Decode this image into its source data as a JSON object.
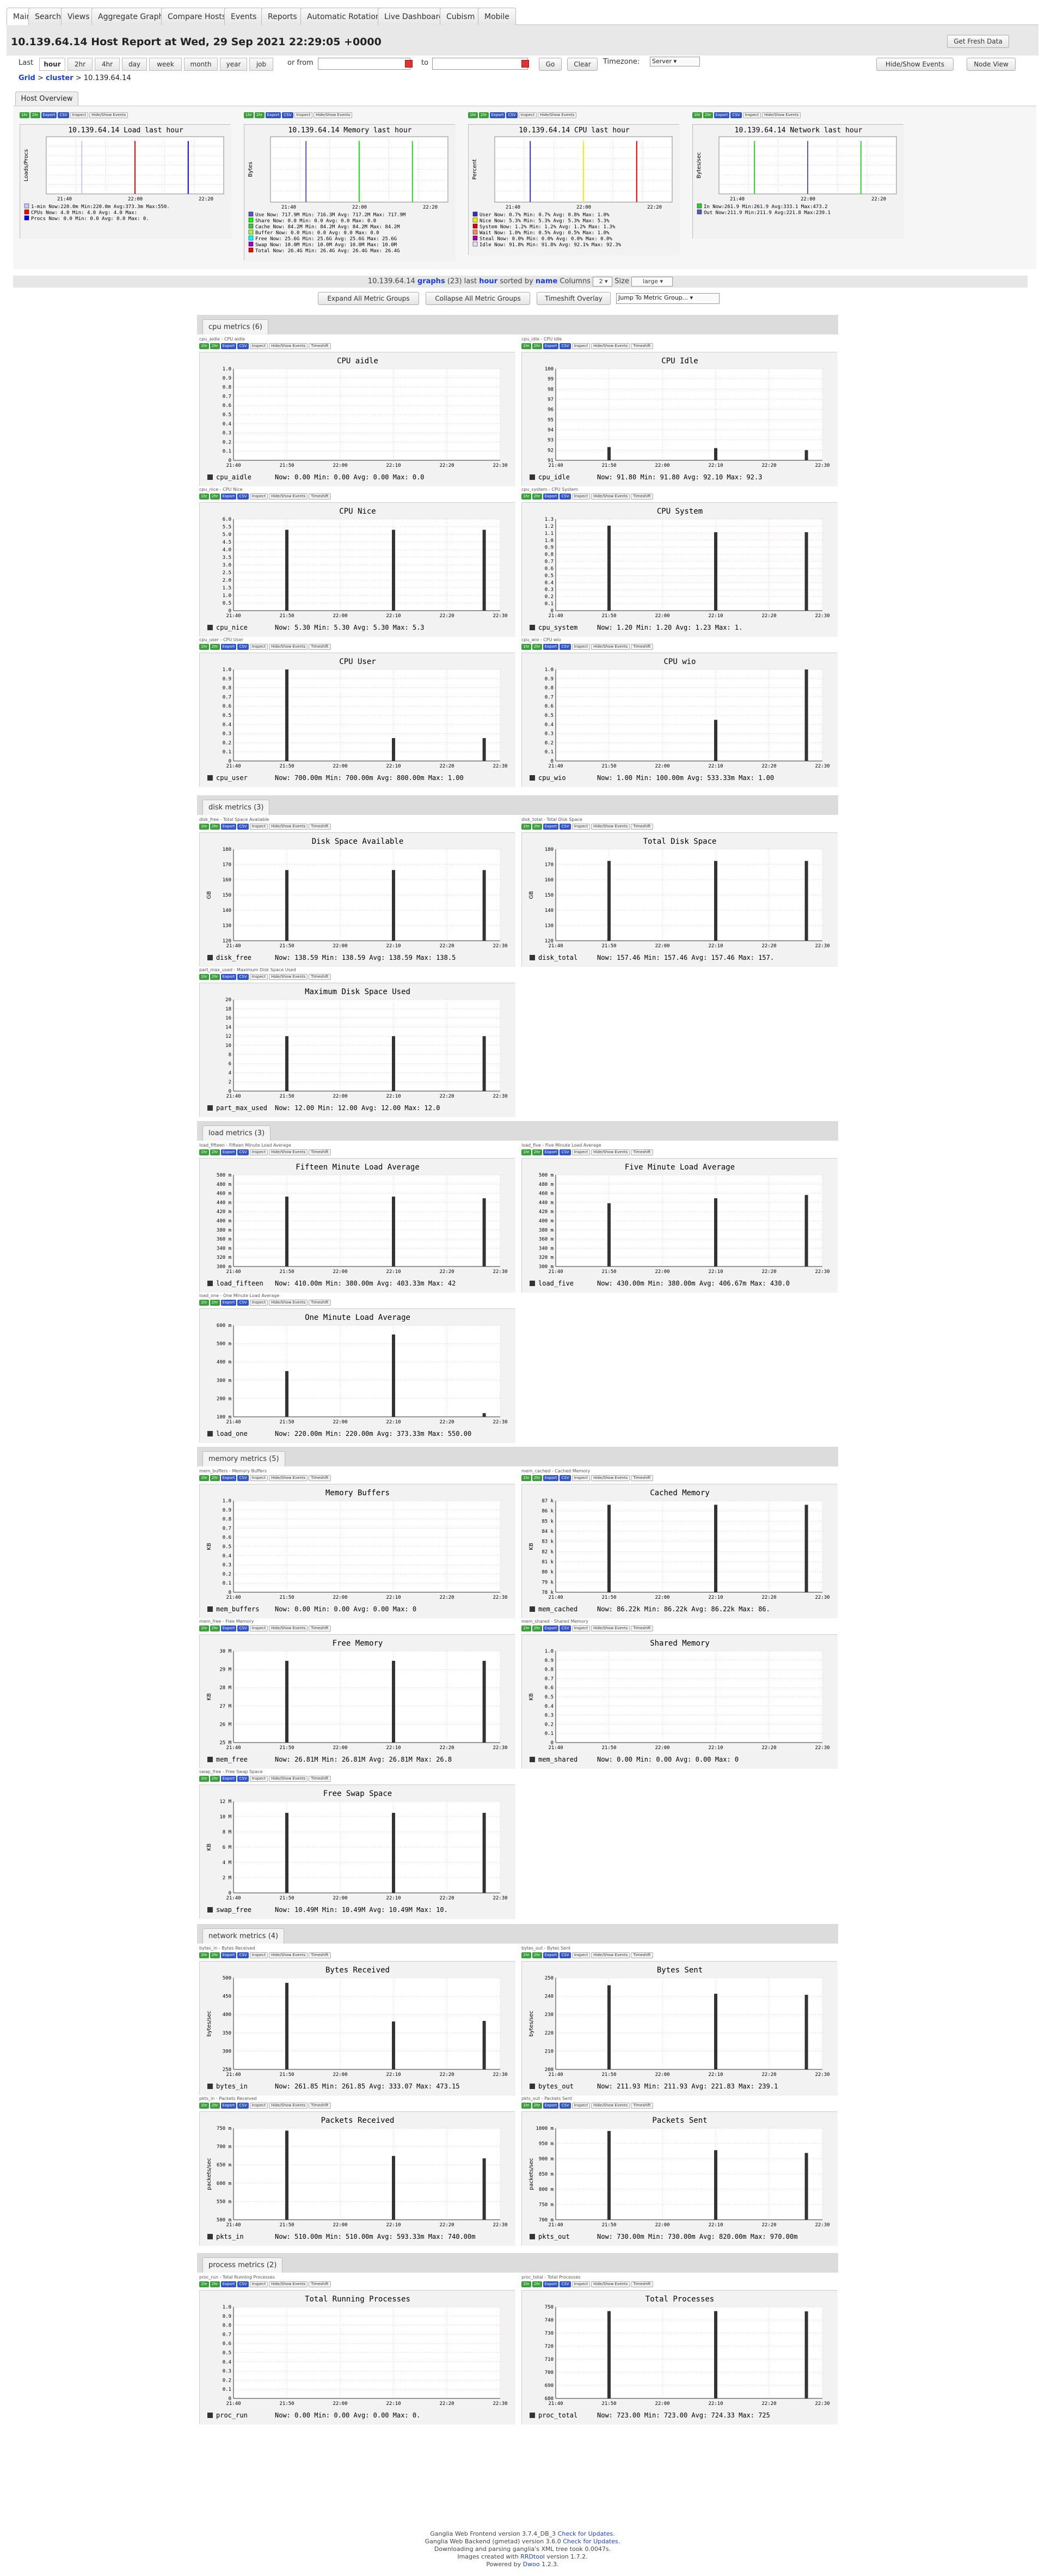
{
  "tabs": [
    "Main",
    "Search",
    "Views",
    "Aggregate Graphs",
    "Compare Hosts",
    "Events",
    "Reports",
    "Automatic Rotation",
    "Live Dashboard",
    "Cubism",
    "Mobile"
  ],
  "title": "10.139.64.14 Host Report at Wed, 29 Sep 2021 22:29:05 +0000",
  "get_fresh": "Get Fresh Data",
  "range": {
    "last_label": "Last",
    "ranges": [
      "hour",
      "2hr",
      "4hr",
      "day",
      "week",
      "month",
      "year",
      "job"
    ],
    "or_from": "or from",
    "to": "to",
    "go": "Go",
    "clear": "Clear",
    "timezone_label": "Timezone:",
    "timezone": "Server"
  },
  "hide_show_events": "Hide/Show Events",
  "node_view": "Node View",
  "breadcrumb": {
    "grid": "Grid",
    "sep1": " > ",
    "cluster": "cluster",
    "sep2": " > ",
    "host": "10.139.64.14"
  },
  "overview_tab": "Host Overview",
  "mini_labels": {
    "one": "1hr",
    "two": "2hr",
    "exp": "Export",
    "csv": "CSV",
    "json": "JSON",
    "inspect": "Inspect",
    "hse": "Hide/Show Events",
    "ts": "Timeshift"
  },
  "overview": [
    {
      "title": "10.139.64.14 Load last hour",
      "ylabel": "Loads/Procs",
      "x": [
        "21:40",
        "22:00",
        "22:20"
      ],
      "legend": [
        "1-min   Now:220.0m  Min:220.0m  Avg:373.3m  Max:550.",
        "CPUs    Now:  4.0   Min:  4.0   Avg:  4.0   Max:",
        "Procs   Now:  0.0   Min:  0.0   Avg:  0.0   Max:  0."
      ]
    },
    {
      "title": "10.139.64.14 Memory last hour",
      "ylabel": "Bytes",
      "x": [
        "21:40",
        "22:00",
        "22:20"
      ],
      "legend": [
        "Use    Now: 717.9M  Min: 716.3M  Avg: 717.2M  Max: 717.9M",
        "Share  Now:   0.0   Min:   0.0   Avg:   0.0   Max:   0.0",
        "Cache  Now:  84.2M  Min:  84.2M  Avg:  84.2M  Max:  84.2M",
        "Buffer Now:   0.0   Min:   0.0   Avg:   0.0   Max:   0.0",
        "Free   Now:  25.6G  Min:  25.6G  Avg:  25.6G  Max:  25.6G",
        "Swap   Now:  10.0M  Min:  10.0M  Avg:  10.0M  Max:  10.0M",
        "Total  Now:  26.4G  Min:  26.4G  Avg:  26.4G  Max:  26.4G"
      ]
    },
    {
      "title": "10.139.64.14 CPU last hour",
      "ylabel": "Percent",
      "x": [
        "21:40",
        "22:00",
        "22:20"
      ],
      "legend": [
        "User    Now:  0.7%  Min:  0.7%  Avg:  0.8%  Max:  1.0%",
        "Nice    Now:  5.3%  Min:  5.3%  Avg:  5.3%  Max:  5.3%",
        "System  Now:  1.2%  Min:  1.2%  Avg:  1.2%  Max:  1.3%",
        "Wait    Now:  1.0%  Min:  0.5%  Avg:  0.5%  Max:  1.0%",
        "Steal   Now:  0.0%  Min:  0.0%  Avg:  0.0%  Max:  0.0%",
        "Idle    Now: 91.8%  Min: 91.8%  Avg: 92.1%  Max: 92.3%"
      ]
    },
    {
      "title": "10.139.64.14 Network last hour",
      "ylabel": "Bytes/sec",
      "x": [
        "21:40",
        "22:00",
        "22:20"
      ],
      "legend": [
        "In    Now:261.9   Min:261.9   Avg:333.1   Max:473.2",
        "Out   Now:211.9   Min:211.9   Avg:221.8   Max:239.1"
      ]
    }
  ],
  "summary": {
    "host": "10.139.64.14",
    "graphs": "graphs",
    "count": "(23)",
    "last": "last",
    "hour": "hour",
    "sorted": "sorted by",
    "name": "name",
    "columns_label": "Columns",
    "columns": "2",
    "size_label": "Size",
    "size": "large"
  },
  "controls": [
    "Expand All Metric Groups",
    "Collapse All Metric Groups",
    "Timeshift Overlay"
  ],
  "jump": "Jump To Metric Group...",
  "groups": [
    {
      "label": "cpu metrics (6)",
      "graphs": [
        {
          "cap": "cpu_aidle - CPU aidle",
          "title": "CPU aidle",
          "metric": "cpu_aidle",
          "legend": "Now:    0.00   Min:    0.00   Avg:    0.00   Max:    0.0",
          "ymin": 0,
          "ymax": 1,
          "yticks": [
            "0",
            "0.1",
            "0.2",
            "0.3",
            "0.4",
            "0.5",
            "0.6",
            "0.7",
            "0.8",
            "0.9",
            "1.0"
          ],
          "bars": [
            0,
            0,
            0
          ]
        },
        {
          "cap": "cpu_idle - CPU Idle",
          "title": "CPU Idle",
          "metric": "cpu_idle",
          "legend": "Now:   91.80   Min:   91.80   Avg:   92.10   Max:   92.3",
          "ymin": 91,
          "ymax": 100,
          "yticks": [
            "91",
            "92",
            "93",
            "94",
            "95",
            "96",
            "97",
            "98",
            "99",
            "100"
          ],
          "bars": [
            92.3,
            92.2,
            92.0
          ]
        },
        {
          "cap": "cpu_nice - CPU Nice",
          "title": "CPU Nice",
          "metric": "cpu_nice",
          "legend": "Now:    5.30   Min:    5.30   Avg:    5.30   Max:    5.3",
          "ymin": 0,
          "ymax": 6,
          "yticks": [
            "0",
            "0.5",
            "1.0",
            "1.5",
            "2.0",
            "2.5",
            "3.0",
            "3.5",
            "4.0",
            "4.5",
            "5.0",
            "5.5",
            "6.0"
          ],
          "bars": [
            5.3,
            5.3,
            5.3
          ]
        },
        {
          "cap": "cpu_system - CPU System",
          "title": "CPU System",
          "metric": "cpu_system",
          "legend": "Now:    1.20   Min:    1.20   Avg:    1.23   Max:    1.",
          "ymin": 0,
          "ymax": 1.4,
          "yticks": [
            "0",
            "0.1",
            "0.2",
            "0.3",
            "0.4",
            "0.5",
            "0.6",
            "0.7",
            "0.8",
            "0.9",
            "1.0",
            "1.1",
            "1.2",
            "1.3"
          ],
          "bars": [
            1.3,
            1.2,
            1.2
          ]
        },
        {
          "cap": "cpu_user - CPU User",
          "title": "CPU User",
          "metric": "cpu_user",
          "legend": "Now:  700.00m  Min:  700.00m  Avg:  800.00m  Max:  1.00",
          "ymin": 0,
          "ymax": 1,
          "yticks": [
            "0",
            "0.1",
            "0.2",
            "0.3",
            "0.4",
            "0.5",
            "0.6",
            "0.7",
            "0.8",
            "0.9",
            "1.0"
          ],
          "bars": [
            1.0,
            0.25,
            0.25
          ]
        },
        {
          "cap": "cpu_wio - CPU wio",
          "title": "CPU wio",
          "metric": "cpu_wio",
          "legend": "Now:    1.00   Min:  100.00m  Avg:  533.33m  Max:    1.00",
          "ymin": 0,
          "ymax": 1,
          "yticks": [
            "0",
            "0.1",
            "0.2",
            "0.3",
            "0.4",
            "0.5",
            "0.6",
            "0.7",
            "0.8",
            "0.9",
            "1.0"
          ],
          "bars": [
            0,
            0.45,
            1.0
          ]
        }
      ]
    },
    {
      "label": "disk metrics (3)",
      "graphs": [
        {
          "cap": "disk_free - Total Space Available",
          "title": "Disk Space Available",
          "metric": "disk_free",
          "ylabel": "GB",
          "legend": "Now:  138.59   Min:  138.59   Avg:  138.59   Max:  138.5",
          "ymin": 0,
          "ymax": 180,
          "yticks": [
            "120",
            "130",
            "140",
            "150",
            "160",
            "170",
            "180"
          ],
          "bars": [
            139,
            139,
            139
          ]
        },
        {
          "cap": "disk_total - Total Disk Space",
          "title": "Total Disk Space",
          "metric": "disk_total",
          "ylabel": "GB",
          "legend": "Now:  157.46   Min:  157.46   Avg:  157.46   Max:  157.",
          "ymin": 0,
          "ymax": 180,
          "yticks": [
            "120",
            "130",
            "140",
            "150",
            "160",
            "170",
            "180"
          ],
          "bars": [
            157,
            157,
            157
          ]
        },
        {
          "cap": "part_max_used - Maximum Disk Space Used",
          "title": "Maximum Disk Space Used",
          "metric": "part_max_used",
          "legend": "Now:   12.00   Min:   12.00   Avg:   12.00   Max:   12.0",
          "ymin": 0,
          "ymax": 20,
          "yticks": [
            "0",
            "2",
            "4",
            "6",
            "8",
            "10",
            "12",
            "14",
            "16",
            "18",
            "20"
          ],
          "bars": [
            12,
            12,
            12
          ]
        }
      ]
    },
    {
      "label": "load metrics (3)",
      "graphs": [
        {
          "cap": "load_fifteen - Fifteen Minute Load Average",
          "title": "Fifteen Minute Load Average",
          "metric": "load_fifteen",
          "legend": "Now:  410.00m  Min:  380.00m  Avg:  403.33m  Max:  42",
          "ymin": 0,
          "ymax": 550,
          "yticks": [
            "300 m",
            "320 m",
            "340 m",
            "360 m",
            "380 m",
            "400 m",
            "420 m",
            "440 m",
            "460 m",
            "480 m",
            "500 m"
          ],
          "bars": [
            420,
            420,
            410
          ]
        },
        {
          "cap": "load_five - Five Minute Load Average",
          "title": "Five Minute Load Average",
          "metric": "load_five",
          "legend": "Now:  430.00m  Min:  380.00m  Avg:  406.67m  Max:  430.0",
          "ymin": 0,
          "ymax": 550,
          "yticks": [
            "300 m",
            "320 m",
            "340 m",
            "360 m",
            "380 m",
            "400 m",
            "420 m",
            "440 m",
            "460 m",
            "480 m",
            "500 m"
          ],
          "bars": [
            380,
            410,
            430
          ]
        },
        {
          "cap": "load_one - One Minute Load Average",
          "title": "One Minute Load Average",
          "metric": "load_one",
          "legend": "Now:  220.00m  Min:  220.00m  Avg:  373.33m  Max:  550.00",
          "ymin": 100,
          "ymax": 600,
          "yticks": [
            "100 m",
            "200 m",
            "300 m",
            "400 m",
            "500 m",
            "600 m"
          ],
          "bars": [
            350,
            550,
            120
          ]
        }
      ]
    },
    {
      "label": "memory metrics (5)",
      "graphs": [
        {
          "cap": "mem_buffers - Memory Buffers",
          "title": "Memory Buffers",
          "metric": "mem_buffers",
          "ylabel": "KB",
          "legend": "Now:    0.00   Min:    0.00   Avg:    0.00   Max:    0",
          "ymin": 0,
          "ymax": 1,
          "yticks": [
            "0",
            "0.1",
            "0.2",
            "0.3",
            "0.4",
            "0.5",
            "0.6",
            "0.7",
            "0.8",
            "0.9",
            "1.0"
          ],
          "bars": [
            0,
            0,
            0
          ]
        },
        {
          "cap": "mem_cached - Cached Memory",
          "title": "Cached Memory",
          "metric": "mem_cached",
          "ylabel": "KB",
          "legend": "Now:   86.22k  Min:   86.22k  Avg:   86.22k  Max:  86.",
          "ymin": 0,
          "ymax": 90,
          "yticks": [
            "78 k",
            "79 k",
            "80 k",
            "81 k",
            "82 k",
            "83 k",
            "84 k",
            "85 k",
            "86 k",
            "87 k"
          ],
          "bars": [
            86,
            86,
            86
          ]
        },
        {
          "cap": "mem_free - Free Memory",
          "title": "Free Memory",
          "metric": "mem_free",
          "ylabel": "KB",
          "legend": "Now:   26.81M  Min:   26.81M  Avg:   26.81M  Max:   26.8",
          "ymin": 0,
          "ymax": 30,
          "yticks": [
            "25 M",
            "26 M",
            "27 M",
            "28 M",
            "29 M",
            "30 M"
          ],
          "bars": [
            26.8,
            26.8,
            26.8
          ]
        },
        {
          "cap": "mem_shared - Shared Memory",
          "title": "Shared Memory",
          "metric": "mem_shared",
          "ylabel": "KB",
          "legend": "Now:    0.00   Min:    0.00   Avg:    0.00   Max:    0",
          "ymin": 0,
          "ymax": 1,
          "yticks": [
            "0",
            "0.1",
            "0.2",
            "0.3",
            "0.4",
            "0.5",
            "0.6",
            "0.7",
            "0.8",
            "0.9",
            "1.0"
          ],
          "bars": [
            0,
            0,
            0
          ]
        },
        {
          "cap": "swap_free - Free Swap Space",
          "title": "Free Swap Space",
          "metric": "swap_free",
          "ylabel": "KB",
          "legend": "Now:   10.49M  Min:   10.49M  Avg:   10.49M  Max:   10.",
          "ymin": 0,
          "ymax": 12,
          "yticks": [
            "0",
            "2 M",
            "4 M",
            "6 M",
            "8 M",
            "10 M",
            "12 M"
          ],
          "bars": [
            10.5,
            10.5,
            10.5
          ]
        }
      ]
    },
    {
      "label": "network metrics (4)",
      "graphs": [
        {
          "cap": "bytes_in - Bytes Received",
          "title": "Bytes Received",
          "metric": "bytes_in",
          "ylabel": "bytes/sec",
          "legend": "Now:  261.85   Min:  261.85   Avg:  333.07   Max:  473.15",
          "ymin": 0,
          "ymax": 500,
          "yticks": [
            "250",
            "300",
            "350",
            "400",
            "450",
            "500"
          ],
          "bars": [
            473,
            262,
            265
          ]
        },
        {
          "cap": "bytes_out - Bytes Sent",
          "title": "Bytes Sent",
          "metric": "bytes_out",
          "ylabel": "bytes/sec",
          "legend": "Now:  211.93   Min:  211.93   Avg:  221.83   Max:  239.1",
          "ymin": 0,
          "ymax": 260,
          "yticks": [
            "200",
            "210",
            "220",
            "230",
            "240",
            "250"
          ],
          "bars": [
            239,
            215,
            212
          ]
        },
        {
          "cap": "pkts_in - Packets Received",
          "title": "Packets Received",
          "metric": "pkts_in",
          "ylabel": "packets/sec",
          "legend": "Now:  510.00m  Min:  510.00m  Avg:  593.33m  Max:  740.00m",
          "ymin": 0,
          "ymax": 760,
          "yticks": [
            "500 m",
            "550 m",
            "600 m",
            "650 m",
            "700 m",
            "750 m"
          ],
          "bars": [
            740,
            530,
            510
          ]
        },
        {
          "cap": "pkts_out - Packets Sent",
          "title": "Packets Sent",
          "metric": "pkts_out",
          "ylabel": "packets/sec",
          "legend": "Now:  730.00m  Min:  730.00m  Avg:  820.00m  Max:  970.00m",
          "ymin": 0,
          "ymax": 1000,
          "yticks": [
            "700 m",
            "750 m",
            "800 m",
            "850 m",
            "900 m",
            "950 m",
            "1000 m"
          ],
          "bars": [
            970,
            760,
            730
          ]
        }
      ]
    },
    {
      "label": "process metrics (2)",
      "graphs": [
        {
          "cap": "proc_run - Total Running Processes",
          "title": "Total Running Processes",
          "metric": "proc_run",
          "legend": "Now:    0.00   Min:    0.00   Avg:    0.00   Max:    0.",
          "ymin": 0,
          "ymax": 1,
          "yticks": [
            "0",
            "0.1",
            "0.2",
            "0.3",
            "0.4",
            "0.5",
            "0.6",
            "0.7",
            "0.8",
            "0.9",
            "1.0"
          ],
          "bars": [
            0,
            0,
            0
          ]
        },
        {
          "cap": "proc_total - Total Processes",
          "title": "Total Processes",
          "metric": "proc_total",
          "legend": "Now:  723.00   Min:  723.00   Avg:  724.33   Max:  725",
          "ymin": 0,
          "ymax": 760,
          "yticks": [
            "680",
            "690",
            "700",
            "710",
            "720",
            "730",
            "740",
            "750"
          ],
          "bars": [
            725,
            725,
            723
          ]
        }
      ]
    }
  ],
  "xticks": [
    "21:40",
    "21:50",
    "22:00",
    "22:10",
    "22:20",
    "22:30"
  ],
  "footer": {
    "l1": "Ganglia Web Frontend version 3.7.4_DB_3",
    "l1a": "Check for Updates.",
    "l2": "Ganglia Web Backend (gmetad) version 3.6.0",
    "l2a": "Check for Updates.",
    "l3": "Downloading and parsing ganglia's XML tree took 0.0047s.",
    "l4": "Images created with",
    "l4a": "RRDtool",
    "l4b": "version 1.7.2.",
    "l5": "Powered by",
    "l5a": "Dwoo",
    "l5b": "1.2.3."
  },
  "colors": {
    "bar": "#333333",
    "grid": "#e6c8c8",
    "link": "#1a3fd0"
  }
}
